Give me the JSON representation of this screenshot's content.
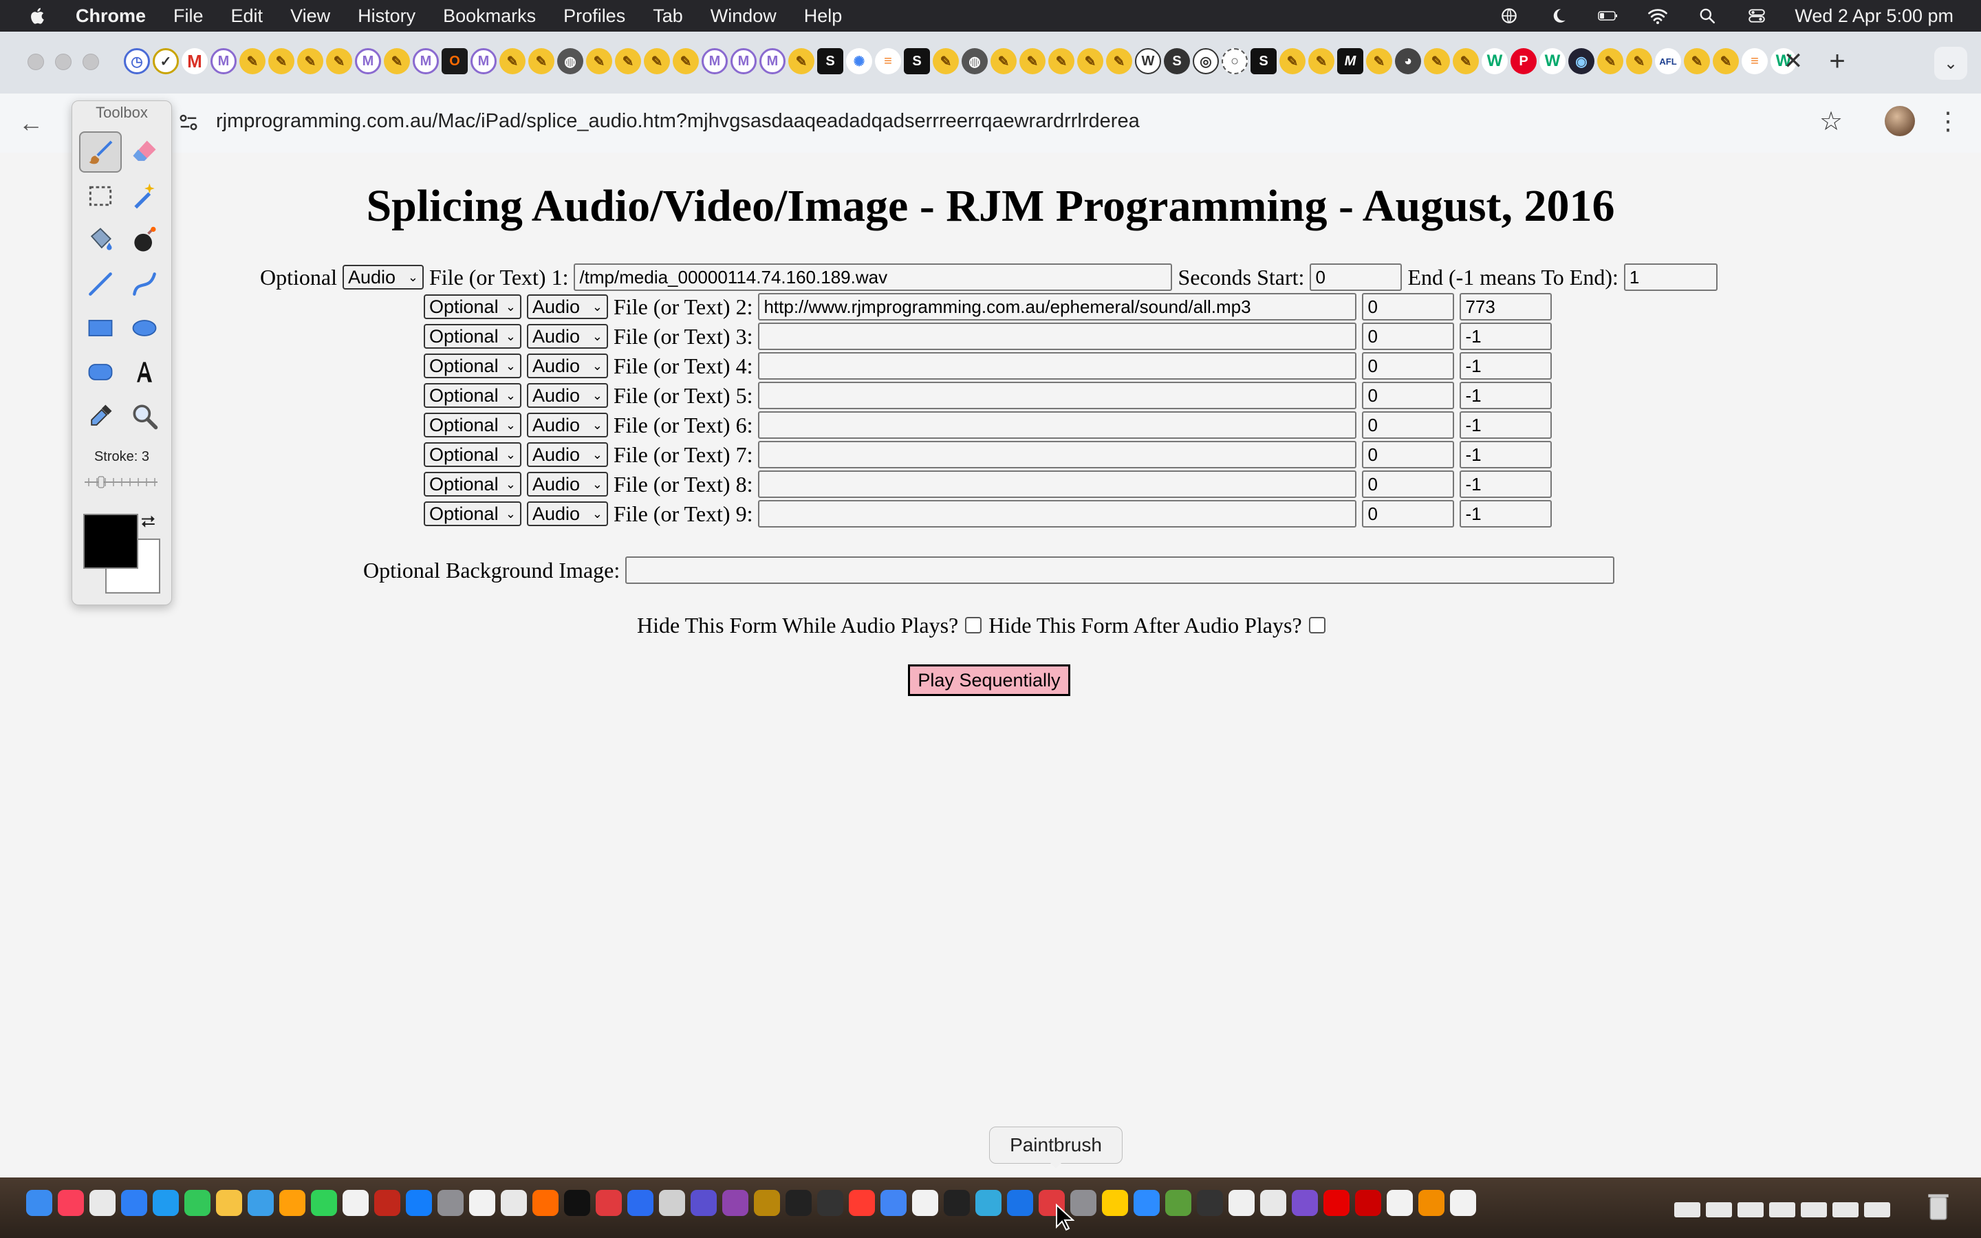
{
  "menubar": {
    "app": "Chrome",
    "items": [
      "File",
      "Edit",
      "View",
      "History",
      "Bookmarks",
      "Profiles",
      "Tab",
      "Window",
      "Help"
    ],
    "clock": "Wed 2 Apr  5:00 pm"
  },
  "browser": {
    "url": "rjmprogramming.com.au/Mac/iPad/splice_audio.htm?mjhvgsasdaaqeadadqadserrreerrqaewrardrrlrderea"
  },
  "page": {
    "title": "Splicing Audio/Video/Image - RJM Programming - August, 2016",
    "row1": {
      "optional_label": "Optional",
      "type": "Audio",
      "file_label": "File (or Text) 1:",
      "file_value": "/tmp/media_00000114.74.160.189.wav",
      "start_label": "Seconds Start:",
      "start_value": "0",
      "end_label": "End (-1 means To End):",
      "end_value": "1"
    },
    "rows": [
      {
        "optional": "Optional",
        "type": "Audio",
        "label": "File (or Text) 2:",
        "file": "http://www.rjmprogramming.com.au/ephemeral/sound/all.mp3",
        "start": "0",
        "end": "773"
      },
      {
        "optional": "Optional",
        "type": "Audio",
        "label": "File (or Text) 3:",
        "file": "",
        "start": "0",
        "end": "-1"
      },
      {
        "optional": "Optional",
        "type": "Audio",
        "label": "File (or Text) 4:",
        "file": "",
        "start": "0",
        "end": "-1"
      },
      {
        "optional": "Optional",
        "type": "Audio",
        "label": "File (or Text) 5:",
        "file": "",
        "start": "0",
        "end": "-1"
      },
      {
        "optional": "Optional",
        "type": "Audio",
        "label": "File (or Text) 6:",
        "file": "",
        "start": "0",
        "end": "-1"
      },
      {
        "optional": "Optional",
        "type": "Audio",
        "label": "File (or Text) 7:",
        "file": "",
        "start": "0",
        "end": "-1"
      },
      {
        "optional": "Optional",
        "type": "Audio",
        "label": "File (or Text) 8:",
        "file": "",
        "start": "0",
        "end": "-1"
      },
      {
        "optional": "Optional",
        "type": "Audio",
        "label": "File (or Text) 9:",
        "file": "",
        "start": "0",
        "end": "-1"
      }
    ],
    "bg_label": "Optional Background Image:",
    "bg_value": "",
    "hide_while_label": "Hide This Form While Audio Plays?",
    "hide_after_label": "Hide This Form After Audio Plays?",
    "play_label": "Play Sequentially",
    "play_color": "#f6b3c0"
  },
  "toolbox": {
    "title": "Toolbox",
    "stroke_label": "Stroke: 3",
    "tools": [
      "paintbrush-icon",
      "eraser-icon",
      "marquee-icon",
      "magic-wand-icon",
      "paint-bucket-icon",
      "bomb-icon",
      "line-icon",
      "curve-icon",
      "rectangle-icon",
      "ellipse-icon",
      "rounded-rect-icon",
      "text-tool-icon",
      "eyedropper-icon",
      "zoom-icon"
    ],
    "foreground": "#000000",
    "background": "#ffffff"
  },
  "tooltip": "Paintbrush"
}
